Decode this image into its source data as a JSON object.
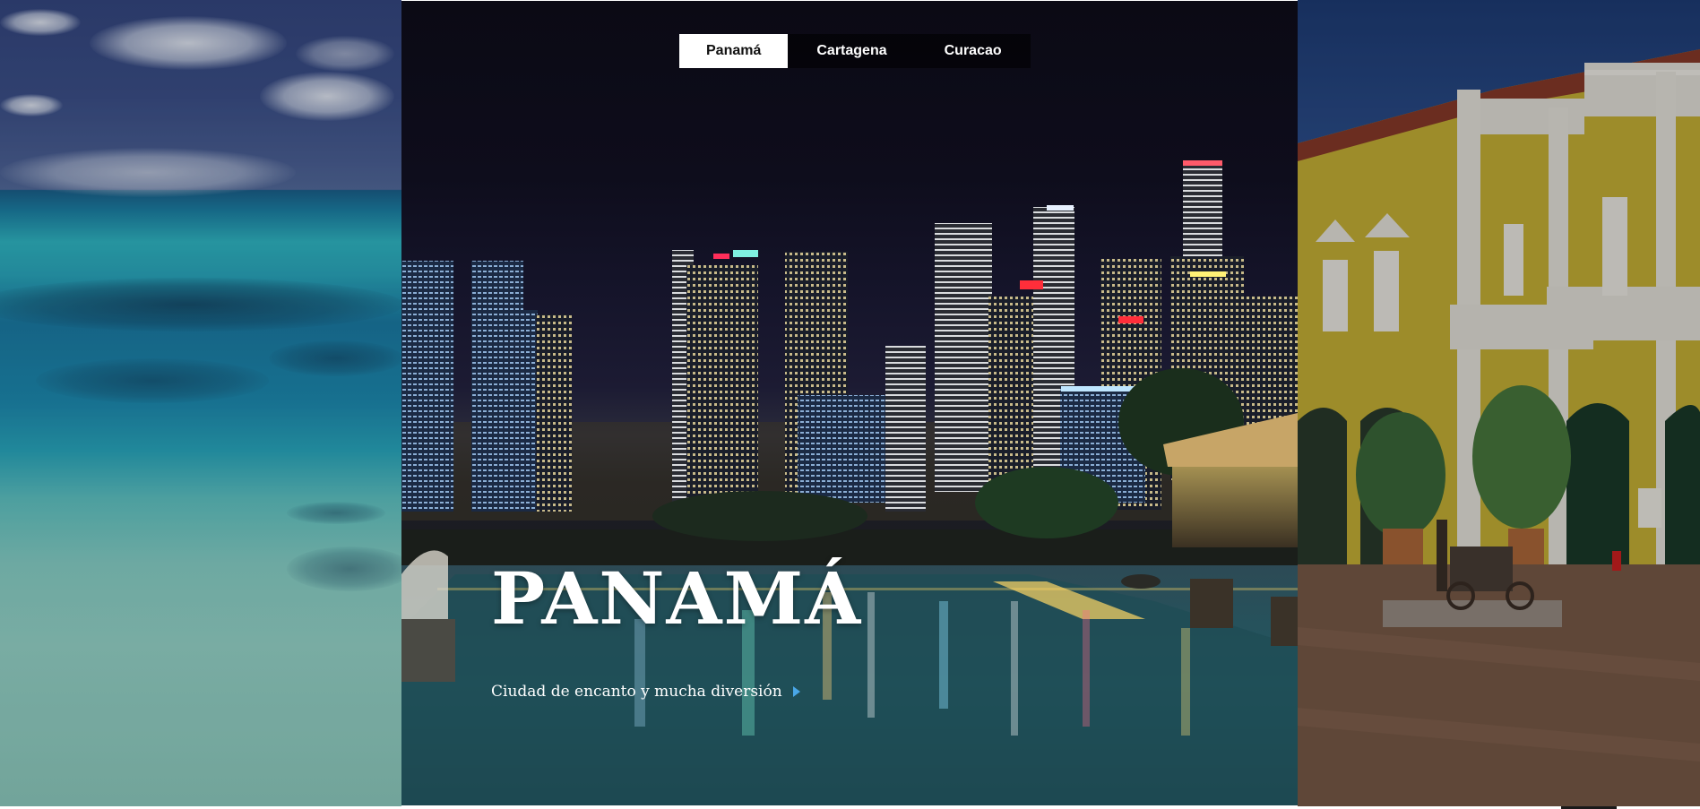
{
  "tabs": [
    {
      "label": "Panamá",
      "active": true
    },
    {
      "label": "Cartagena",
      "active": false
    },
    {
      "label": "Curacao",
      "active": false
    }
  ],
  "hero": {
    "title": "PANAMÁ",
    "subtitle": "Ciudad de encanto y mucha diversión",
    "arrow_icon": "play-arrow-icon",
    "arrow_color": "#4aa7e8"
  },
  "slides": [
    {
      "scene": "ocean-reef"
    },
    {
      "scene": "city-skyline-night"
    },
    {
      "scene": "colonial-building"
    }
  ]
}
